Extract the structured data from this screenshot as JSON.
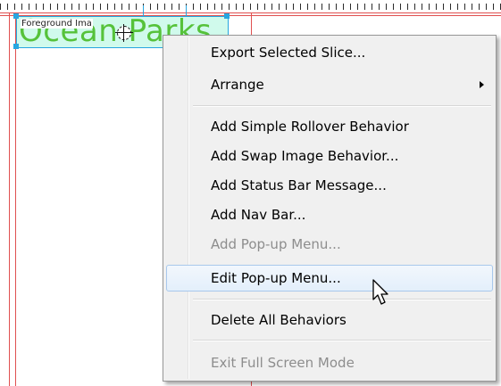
{
  "canvas": {
    "slice_text": "Ocean Parks",
    "slice_label": "Foreground Ima"
  },
  "colors": {
    "guide": "#e05050",
    "slice_border": "#27a6e0",
    "slice_text": "#56c23a",
    "menu_bg": "#f0f0f0",
    "disabled_text": "#8d8d8d",
    "hover_border": "#a8c8ec"
  },
  "context_menu": {
    "items": [
      {
        "label": "Export Selected Slice...",
        "enabled": true
      },
      {
        "label": "Arrange",
        "enabled": true,
        "submenu": true
      },
      {
        "label": "Add Simple Rollover Behavior",
        "enabled": true
      },
      {
        "label": "Add Swap Image Behavior...",
        "enabled": true
      },
      {
        "label": "Add Status Bar Message...",
        "enabled": true
      },
      {
        "label": "Add Nav Bar...",
        "enabled": true
      },
      {
        "label": "Add Pop-up Menu...",
        "enabled": false
      },
      {
        "label": "Edit Pop-up Menu...",
        "enabled": true,
        "hovered": true
      },
      {
        "label": "Delete All Behaviors",
        "enabled": true
      },
      {
        "label": "Exit Full Screen Mode",
        "enabled": false
      }
    ]
  },
  "icons": [
    "crosshair-icon",
    "submenu-arrow-icon",
    "mouse-pointer-icon"
  ]
}
